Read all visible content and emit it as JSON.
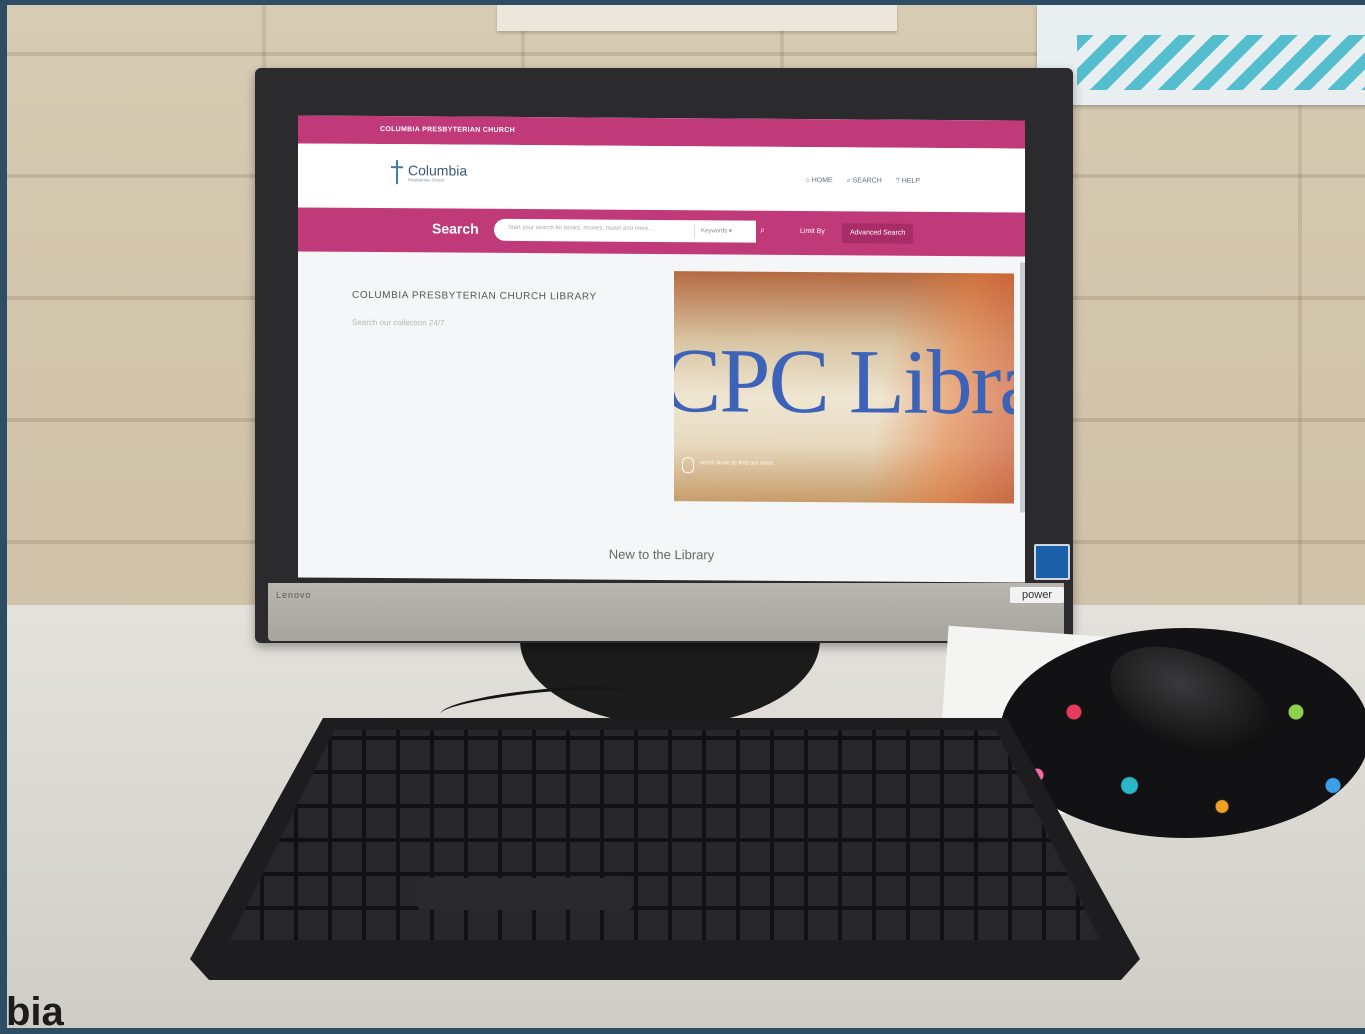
{
  "site": {
    "topbar_title": "COLUMBIA PRESBYTERIAN CHURCH",
    "logo_name": "Columbia",
    "logo_subtitle": "Presbyterian Church",
    "nav": [
      {
        "label": "HOME",
        "icon": "home-icon"
      },
      {
        "label": "SEARCH",
        "icon": "search-icon"
      },
      {
        "label": "HELP",
        "icon": "help-icon"
      }
    ]
  },
  "search": {
    "label": "Search",
    "placeholder": "Start your search for books, movies, music and more...",
    "keywords_label": "Keywords",
    "limit_label": "Limit By",
    "advanced_label": "Advanced Search"
  },
  "main": {
    "library_title": "COLUMBIA PRESBYTERIAN CHURCH LIBRARY",
    "library_subtitle": "Search our collection 24/7",
    "hero_text": "CPC Library",
    "hero_caption": "scroll down to find out more",
    "new_section": "New to the Library"
  },
  "hardware": {
    "brand": "Lenovo",
    "power_label": "power"
  },
  "caption": {
    "overlay_text": "bia"
  },
  "colors": {
    "accent": "#c03a7a",
    "hero_text": "#3d63b8"
  }
}
